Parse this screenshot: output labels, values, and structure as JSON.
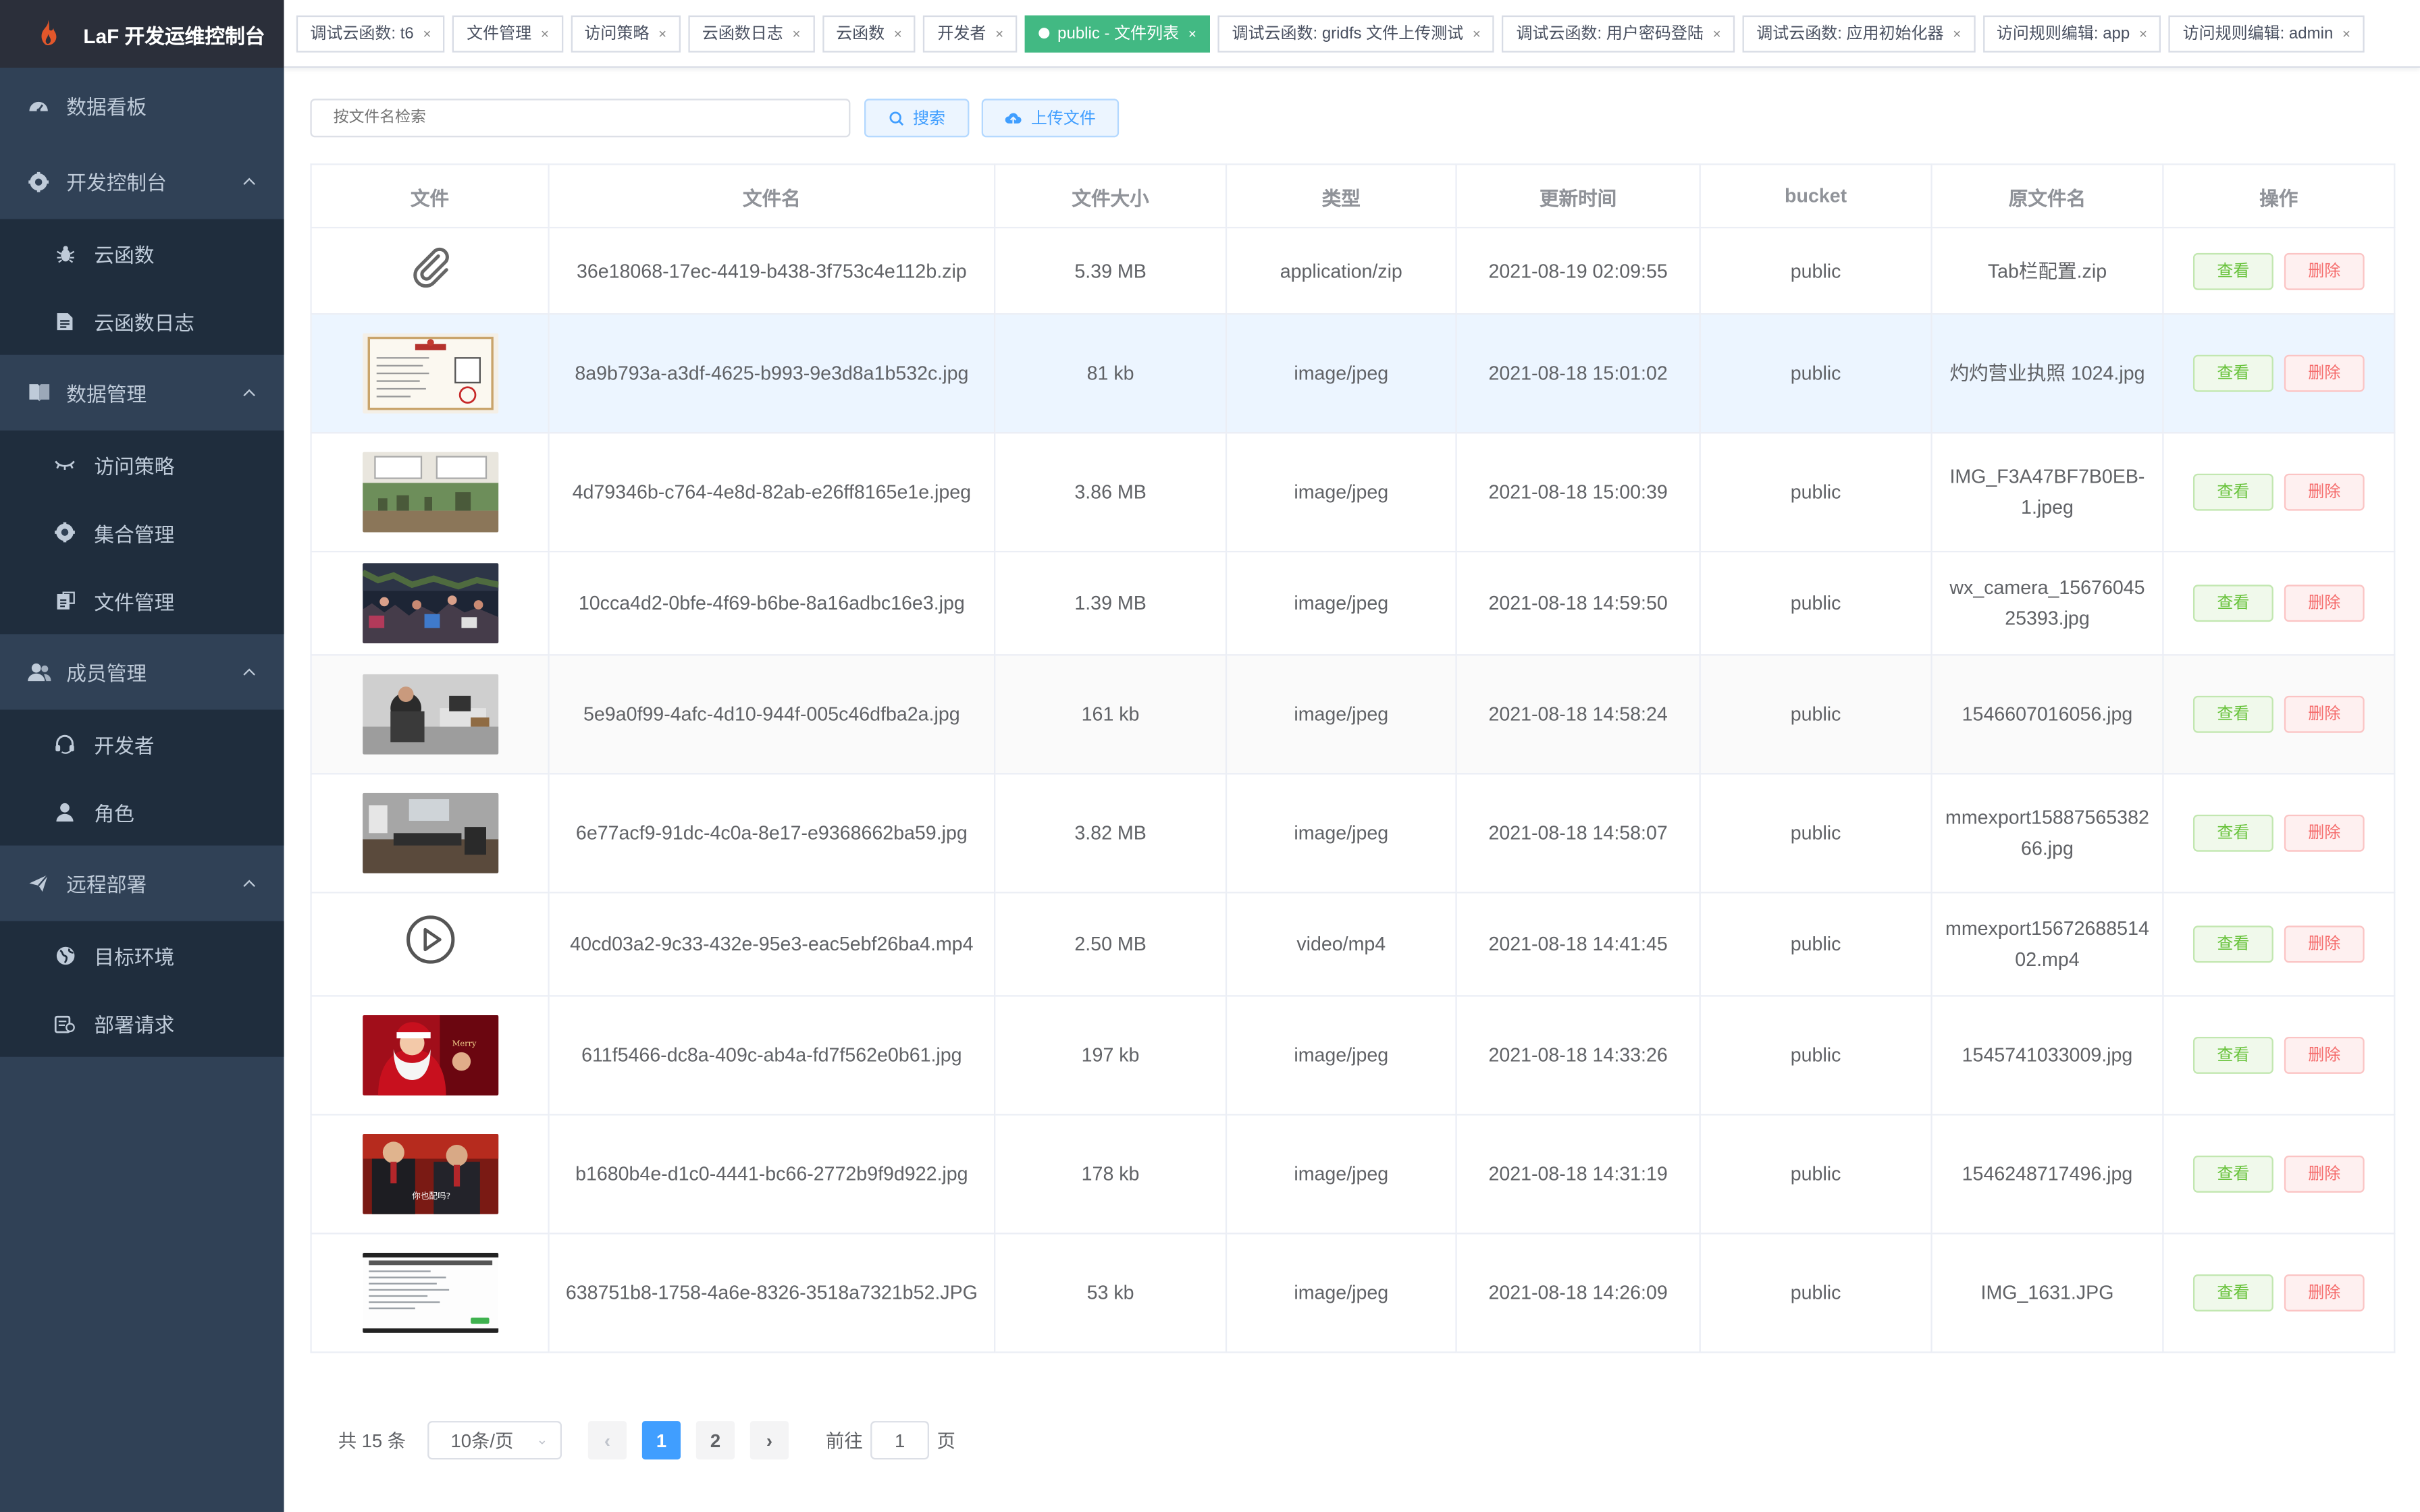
{
  "brand": {
    "title": "LaF 开发运维控制台"
  },
  "sidebar": {
    "items": [
      {
        "label": "数据看板",
        "icon": "dashboard-icon",
        "children": []
      },
      {
        "label": "开发控制台",
        "icon": "gear-icon",
        "expanded": true,
        "children": [
          {
            "label": "云函数",
            "icon": "bug-icon"
          },
          {
            "label": "云函数日志",
            "icon": "document-icon"
          }
        ]
      },
      {
        "label": "数据管理",
        "icon": "book-icon",
        "expanded": true,
        "children": [
          {
            "label": "访问策略",
            "icon": "eye-icon"
          },
          {
            "label": "集合管理",
            "icon": "gear-icon"
          },
          {
            "label": "文件管理",
            "icon": "folder-icon"
          }
        ]
      },
      {
        "label": "成员管理",
        "icon": "users-icon",
        "expanded": true,
        "children": [
          {
            "label": "开发者",
            "icon": "headset-icon"
          },
          {
            "label": "角色",
            "icon": "user-icon"
          }
        ]
      },
      {
        "label": "远程部署",
        "icon": "send-icon",
        "expanded": true,
        "children": [
          {
            "label": "目标环境",
            "icon": "globe-icon"
          },
          {
            "label": "部署请求",
            "icon": "request-icon"
          }
        ]
      }
    ]
  },
  "tabs": [
    {
      "label": "调试云函数: t6",
      "active": false
    },
    {
      "label": "文件管理",
      "active": false
    },
    {
      "label": "访问策略",
      "active": false
    },
    {
      "label": "云函数日志",
      "active": false
    },
    {
      "label": "云函数",
      "active": false
    },
    {
      "label": "开发者",
      "active": false
    },
    {
      "label": "public - 文件列表",
      "active": true
    },
    {
      "label": "调试云函数: gridfs 文件上传测试",
      "active": false
    },
    {
      "label": "调试云函数: 用户密码登陆",
      "active": false
    },
    {
      "label": "调试云函数: 应用初始化器",
      "active": false
    },
    {
      "label": "访问规则编辑: app",
      "active": false
    },
    {
      "label": "访问规则编辑: admin",
      "active": false
    }
  ],
  "toolbar": {
    "search_placeholder": "按文件名检索",
    "search_label": "搜索",
    "upload_label": "上传文件"
  },
  "table": {
    "headers": [
      "文件",
      "文件名",
      "文件大小",
      "类型",
      "更新时间",
      "bucket",
      "原文件名",
      "操作"
    ],
    "view_label": "查看",
    "delete_label": "删除",
    "rows": [
      {
        "preview": "attachment-icon",
        "filename": "36e18068-17ec-4419-b438-3f753c4e112b.zip",
        "size": "5.39 MB",
        "type": "application/zip",
        "updated": "2021-08-19 02:09:55",
        "bucket": "public",
        "original": "Tab栏配置.zip",
        "style": ""
      },
      {
        "preview": "license",
        "filename": "8a9b793a-a3df-4625-b993-9e3d8a1b532c.jpg",
        "size": "81 kb",
        "type": "image/jpeg",
        "updated": "2021-08-18 15:01:02",
        "bucket": "public",
        "original": "灼灼营业执照 1024.jpg",
        "style": "hl"
      },
      {
        "preview": "board",
        "filename": "4d79346b-c764-4e8d-82ab-e26ff8165e1e.jpeg",
        "size": "3.86 MB",
        "type": "image/jpeg",
        "updated": "2021-08-18 15:00:39",
        "bucket": "public",
        "original": "IMG_F3A47BF7B0EB-1.jpeg",
        "style": ""
      },
      {
        "preview": "crowd",
        "filename": "10cca4d2-0bfe-4f69-b6be-8a16adbc16e3.jpg",
        "size": "1.39 MB",
        "type": "image/jpeg",
        "updated": "2021-08-18 14:59:50",
        "bucket": "public",
        "original": "wx_camera_1567604525393.jpg",
        "style": ""
      },
      {
        "preview": "office",
        "filename": "5e9a0f99-4afc-4d10-944f-005c46dfba2a.jpg",
        "size": "161 kb",
        "type": "image/jpeg",
        "updated": "2021-08-18 14:58:24",
        "bucket": "public",
        "original": "1546607016056.jpg",
        "style": "stripe"
      },
      {
        "preview": "room",
        "filename": "6e77acf9-91dc-4c0a-8e17-e9368662ba59.jpg",
        "size": "3.82 MB",
        "type": "image/jpeg",
        "updated": "2021-08-18 14:58:07",
        "bucket": "public",
        "original": "mmexport1588756538266.jpg",
        "style": ""
      },
      {
        "preview": "play-icon",
        "filename": "40cd03a2-9c33-432e-95e3-eac5ebf26ba4.mp4",
        "size": "2.50 MB",
        "type": "video/mp4",
        "updated": "2021-08-18 14:41:45",
        "bucket": "public",
        "original": "mmexport1567268851402.mp4",
        "style": ""
      },
      {
        "preview": "santa",
        "filename": "611f5466-dc8a-409c-ab4a-fd7f562e0b61.jpg",
        "size": "197 kb",
        "type": "image/jpeg",
        "updated": "2021-08-18 14:33:26",
        "bucket": "public",
        "original": "1545741033009.jpg",
        "style": ""
      },
      {
        "preview": "people",
        "filename": "b1680b4e-d1c0-4441-bc66-2772b9f9d922.jpg",
        "size": "178 kb",
        "type": "image/jpeg",
        "updated": "2021-08-18 14:31:19",
        "bucket": "public",
        "original": "1546248717496.jpg",
        "style": ""
      },
      {
        "preview": "screenshot",
        "filename": "638751b8-1758-4a6e-8326-3518a7321b52.JPG",
        "size": "53 kb",
        "type": "image/jpeg",
        "updated": "2021-08-18 14:26:09",
        "bucket": "public",
        "original": "IMG_1631.JPG",
        "style": ""
      }
    ]
  },
  "pagination": {
    "total_label": "共 15 条",
    "page_size_label": "10条/页",
    "pages": [
      "1",
      "2"
    ],
    "current_page": "1",
    "goto_prefix": "前往",
    "goto_value": "1",
    "goto_suffix": "页"
  },
  "colors": {
    "sidebar_bg": "#304156",
    "submenu_bg": "#1f2d3d",
    "active_tab": "#42b983",
    "primary": "#409eff"
  }
}
